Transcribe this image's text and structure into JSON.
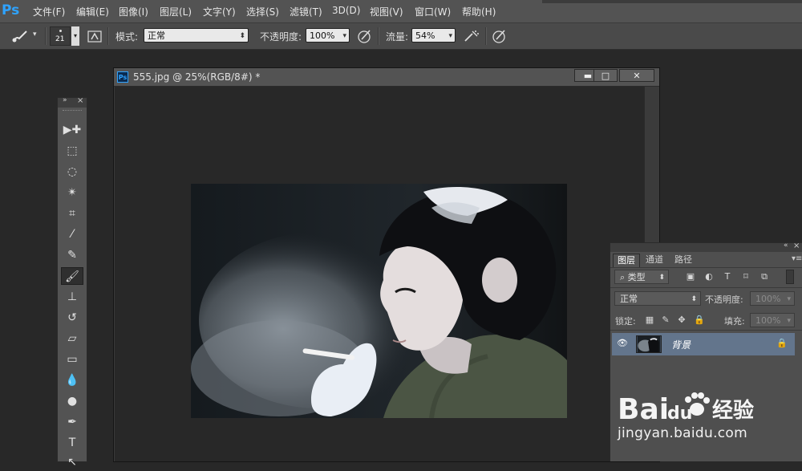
{
  "app": {
    "logo": "Ps",
    "menu": [
      "文件(F)",
      "编辑(E)",
      "图像(I)",
      "图层(L)",
      "文字(Y)",
      "选择(S)",
      "滤镜(T)",
      "3D(D)",
      "视图(V)",
      "窗口(W)",
      "帮助(H)"
    ]
  },
  "options": {
    "brush_size": "21",
    "mode_label": "模式:",
    "mode_value": "正常",
    "opacity_label": "不透明度:",
    "opacity_value": "100%",
    "flow_label": "流量:",
    "flow_value": "54%"
  },
  "document": {
    "title": "555.jpg @ 25%(RGB/8#) *",
    "ps_badge": "Ps",
    "minimize": "▬",
    "maximize": "□",
    "close": "✕"
  },
  "tools_panel": {
    "collapse": "»",
    "close": "×",
    "tools": [
      {
        "name": "move",
        "glyph": "▶✚"
      },
      {
        "name": "marquee",
        "glyph": "⬚"
      },
      {
        "name": "lasso",
        "glyph": "◌"
      },
      {
        "name": "magic-wand",
        "glyph": "✴"
      },
      {
        "name": "crop",
        "glyph": "⌗"
      },
      {
        "name": "eyedropper",
        "glyph": "⁄"
      },
      {
        "name": "healing-brush",
        "glyph": "✎"
      },
      {
        "name": "brush",
        "glyph": "🖌"
      },
      {
        "name": "clone-stamp",
        "glyph": "⊥"
      },
      {
        "name": "history-brush",
        "glyph": "↺"
      },
      {
        "name": "eraser",
        "glyph": "▱"
      },
      {
        "name": "gradient",
        "glyph": "▭"
      },
      {
        "name": "blur",
        "glyph": "💧"
      },
      {
        "name": "dodge",
        "glyph": "●"
      },
      {
        "name": "pen",
        "glyph": "✒"
      },
      {
        "name": "type",
        "glyph": "T"
      },
      {
        "name": "path-selection",
        "glyph": "↖"
      }
    ],
    "active_tool": "brush"
  },
  "layers_panel": {
    "collapse": "«",
    "close": "×",
    "tabs": [
      "图层",
      "通道",
      "路径"
    ],
    "active_tab": "图层",
    "menu": "▾≡",
    "filter_value": "类型",
    "blend_mode": "正常",
    "opacity_label": "不透明度:",
    "opacity_value": "100%",
    "lock_label": "锁定:",
    "fill_label": "填充:",
    "fill_value": "100%",
    "layer_name": "背景",
    "eye": "👁",
    "lock": "🔒"
  },
  "watermark": {
    "brand_left": "Bai",
    "brand_right": "du",
    "brand_cn": "经验",
    "url": "jingyan.baidu.com"
  },
  "colors": {
    "accent": "#2fa3ff",
    "layer_selected": "#63758c",
    "ui_gray": "#535353",
    "canvas_bg": "#282828"
  }
}
